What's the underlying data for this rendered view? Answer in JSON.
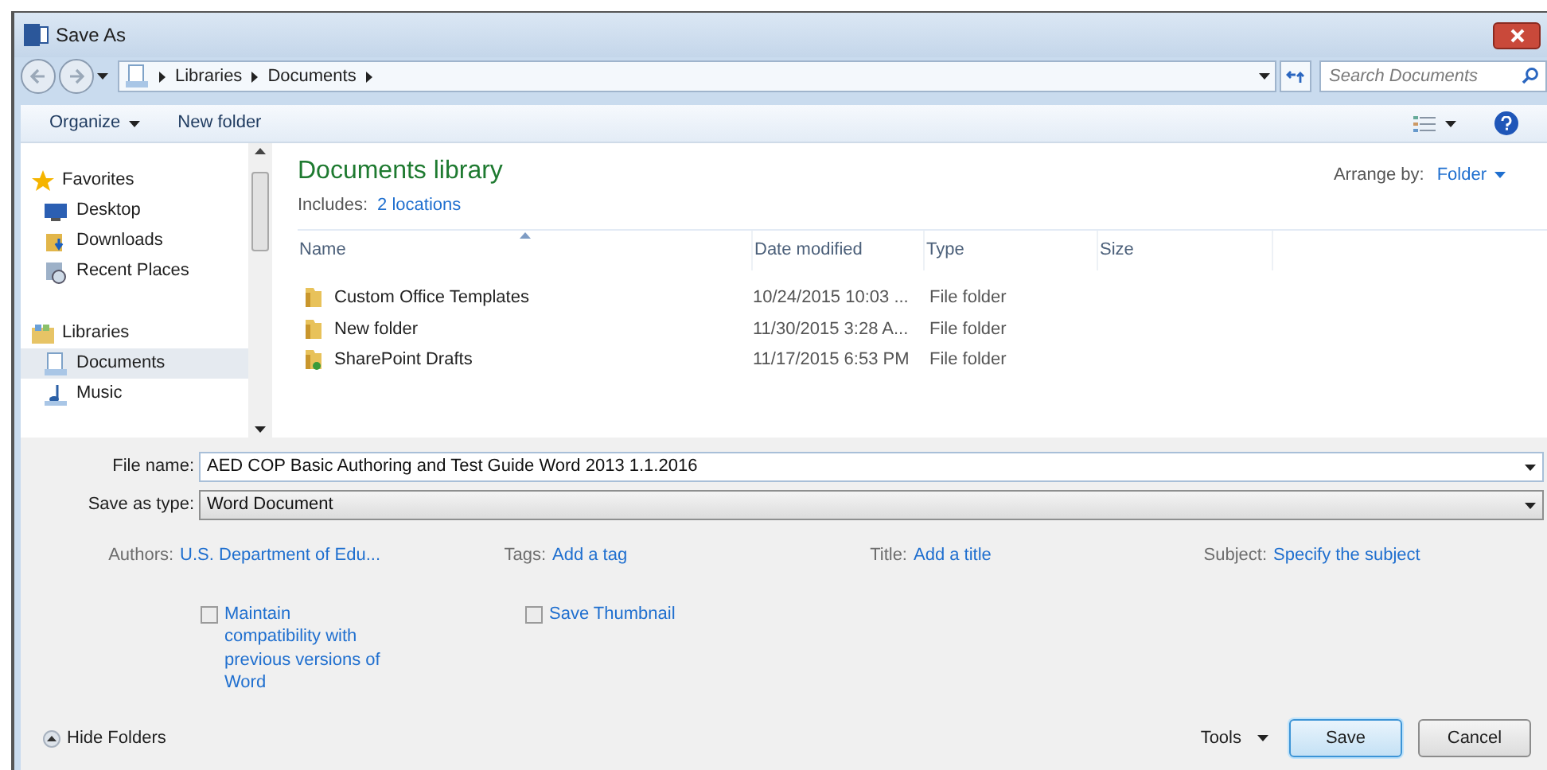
{
  "window": {
    "title": "Save As"
  },
  "address": {
    "path": [
      "Libraries",
      "Documents"
    ],
    "search_placeholder": "Search Documents"
  },
  "toolbar": {
    "buttons": [
      {
        "label": "Organize",
        "kind": "menu"
      },
      {
        "label": "New folder",
        "kind": "plain"
      }
    ]
  },
  "sidebar": {
    "groups": [
      {
        "label": "Favorites",
        "kind": "star",
        "children": [
          {
            "label": "Desktop",
            "kind": "desktop",
            "selected": false
          },
          {
            "label": "Downloads",
            "kind": "downloads",
            "selected": false
          },
          {
            "label": "Recent Places",
            "kind": "recent",
            "selected": false
          }
        ]
      },
      {
        "label": "Libraries",
        "kind": "library",
        "children": [
          {
            "label": "Documents",
            "kind": "documents",
            "selected": true
          },
          {
            "label": "Music",
            "kind": "music",
            "selected": false
          }
        ]
      }
    ]
  },
  "library": {
    "title": "Documents library",
    "includes_label": "Includes:",
    "includes_link": "2 locations",
    "arrange_label": "Arrange by:",
    "arrange_value": "Folder"
  },
  "table": {
    "columns": [
      {
        "label": "Name",
        "sorted": true
      },
      {
        "label": "Date modified",
        "sorted": false
      },
      {
        "label": "Type",
        "sorted": false
      },
      {
        "label": "Size",
        "sorted": false
      }
    ],
    "rows": [
      {
        "name": "Custom Office Templates",
        "kind": "folder",
        "date": "10/24/2015 10:03 ...",
        "type": "File folder"
      },
      {
        "name": "New folder",
        "kind": "folder",
        "date": "11/30/2015 3:28 A...",
        "type": "File folder"
      },
      {
        "name": "SharePoint Drafts",
        "kind": "shared",
        "date": "11/17/2015 6:53 PM",
        "type": "File folder"
      }
    ]
  },
  "form": {
    "file_name_label": "File name:",
    "file_name": "AED COP Basic Authoring and Test Guide Word 2013 1.1.2016",
    "type_label": "Save as type:",
    "type": "Word Document"
  },
  "metadata": [
    {
      "label": "Authors:",
      "value": "U.S. Department of Edu..."
    },
    {
      "label": "Tags:",
      "value": "Add a tag"
    },
    {
      "label": "Title:",
      "value": "Add a title"
    },
    {
      "label": "Subject:",
      "value": "Specify the subject"
    }
  ],
  "options": [
    {
      "label": "Maintain compatibility with previous versions of Word",
      "checked": false
    },
    {
      "label": "Save Thumbnail",
      "checked": false
    }
  ],
  "footer": {
    "hide_folders": "Hide Folders",
    "tools": "Tools",
    "save": "Save",
    "cancel": "Cancel"
  }
}
